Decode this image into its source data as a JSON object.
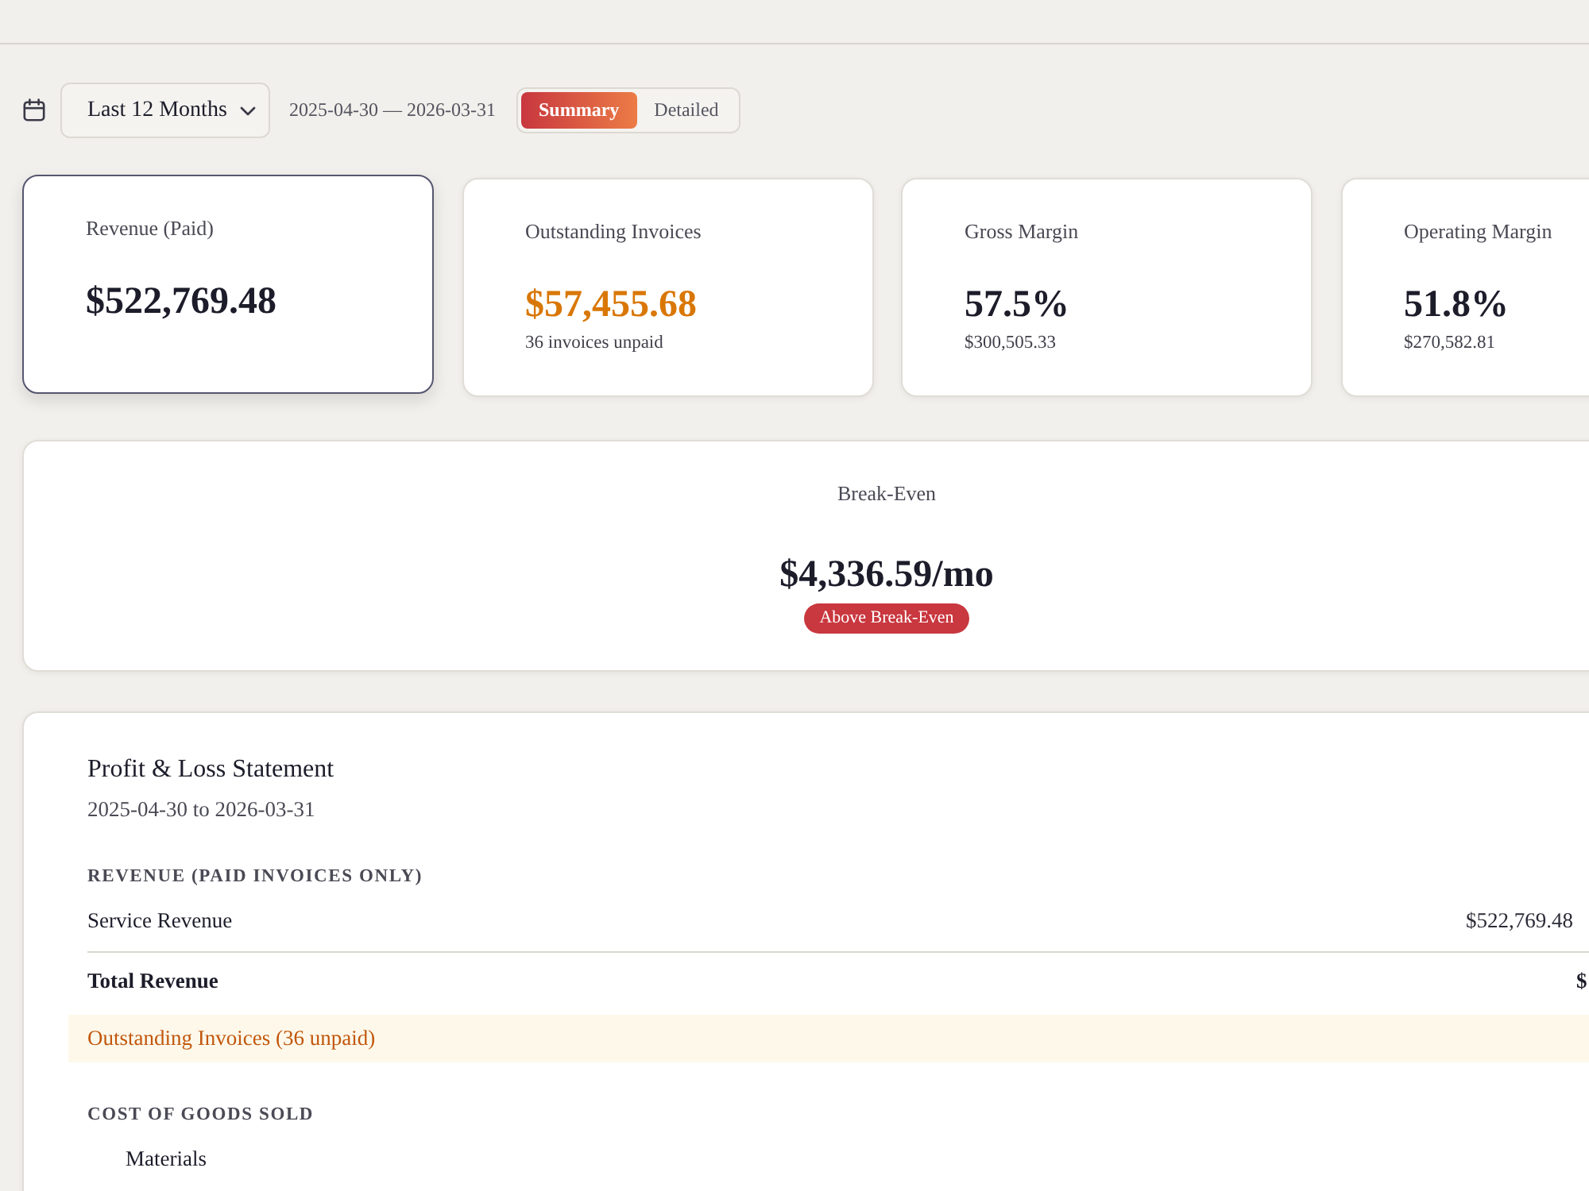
{
  "toolbar": {
    "period": {
      "value": "Last 12 Months"
    },
    "date_range": "2025-04-30 — 2026-03-31",
    "view_tabs": [
      {
        "label": "Summary",
        "selected": true
      },
      {
        "label": "Detailed",
        "selected": false
      }
    ]
  },
  "kpi_cards": [
    {
      "label": "Revenue (Paid)",
      "value": "$522,769.48",
      "kind": "plain",
      "selected": true
    },
    {
      "label": "Outstanding Invoices",
      "value": "$57,455.68",
      "note": "36 invoices unpaid",
      "kind": "warning",
      "selected": false
    },
    {
      "label": "Gross Margin",
      "value": "57.5%",
      "note": "$300,505.33",
      "kind": "plain",
      "selected": false
    },
    {
      "label": "Operating Margin",
      "value": "51.8%",
      "note": "$270,582.81",
      "kind": "plain",
      "selected": false
    }
  ],
  "break_even": {
    "label": "Break-Even",
    "value": "$4,336.59/mo",
    "badge": "Above Break-Even"
  },
  "statement": {
    "title": "Profit & Loss Statement",
    "period": "2025-04-30 to 2026-03-31",
    "rows": [
      {
        "kind": "section",
        "label": "REVENUE (PAID INVOICES ONLY)"
      },
      {
        "kind": "item",
        "label": "Service Revenue",
        "amount": "$522,769.48"
      },
      {
        "kind": "total",
        "label": "Total Revenue",
        "amount": "$"
      },
      {
        "kind": "notice",
        "label": "Outstanding Invoices (36 unpaid)"
      },
      {
        "kind": "section",
        "label": "COST OF GOODS SOLD"
      },
      {
        "kind": "subitem",
        "label": "Materials"
      }
    ]
  }
}
